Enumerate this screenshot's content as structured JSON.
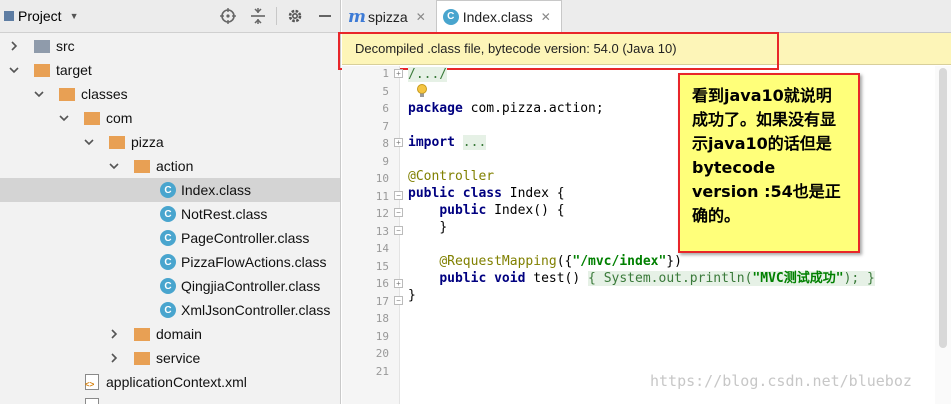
{
  "project": {
    "title": "Project",
    "tree": [
      {
        "label": "src",
        "icon": "folder-gray-icon",
        "expanded": false
      },
      {
        "label": "target",
        "icon": "folder-orange-icon",
        "expanded": true
      },
      {
        "label": "classes",
        "icon": "folder-orange-icon",
        "expanded": true
      },
      {
        "label": "com",
        "icon": "folder-orange-icon",
        "expanded": true
      },
      {
        "label": "pizza",
        "icon": "folder-orange-icon",
        "expanded": true
      },
      {
        "label": "action",
        "icon": "folder-orange-icon",
        "expanded": true
      },
      {
        "label": "Index.class",
        "icon": "class-icon",
        "selected": true
      },
      {
        "label": "NotRest.class",
        "icon": "class-icon"
      },
      {
        "label": "PageController.class",
        "icon": "class-icon"
      },
      {
        "label": "PizzaFlowActions.class",
        "icon": "class-icon"
      },
      {
        "label": "QingjiaController.class",
        "icon": "class-icon"
      },
      {
        "label": "XmlJsonController.class",
        "icon": "class-icon"
      },
      {
        "label": "domain",
        "icon": "folder-orange-icon",
        "expanded": false
      },
      {
        "label": "service",
        "icon": "folder-orange-icon",
        "expanded": false
      },
      {
        "label": "applicationContext.xml",
        "icon": "xml-file-icon"
      }
    ]
  },
  "tabs": [
    {
      "label": "spizza",
      "icon": "maven-m-icon",
      "active": false
    },
    {
      "label": "Index.class",
      "icon": "class-icon",
      "active": true
    }
  ],
  "banner": {
    "text": "Decompiled .class file, bytecode version: 54.0 (Java 10)"
  },
  "code": {
    "line_numbers": [
      "1",
      "5",
      "6",
      "7",
      "8",
      "9",
      "10",
      "11",
      "12",
      "13",
      "14",
      "15",
      "16",
      "17",
      "18",
      "19",
      "20",
      "21"
    ],
    "lines": {
      "l1": "/.../",
      "l6_kw": "package",
      "l6_rest": " com.pizza.action;",
      "l8_kw": "import",
      "l8_rest": "...",
      "l10": "@Controller",
      "l11_kw1": "public",
      "l11_kw2": "class",
      "l11_rest": " Index {",
      "l12_kw": "public",
      "l12_rest": " Index() {",
      "l13": "}",
      "l15_ann": "@RequestMapping",
      "l15_p1": "({",
      "l15_str": "\"/mvc/index\"",
      "l15_p2": "})",
      "l16_kw1": "public",
      "l16_kw2": "void",
      "l16_rest": " test() ",
      "l16_body1": "{",
      "l16_body2": " System.out.println(",
      "l16_str": "\"MVC测试成功\"",
      "l16_body3": "); ",
      "l16_body4": "}",
      "l17": "}"
    }
  },
  "annotation": {
    "text": "看到java10就说明成功了。如果没有显示java10的话但是bytecode version :54也是正确的。"
  },
  "watermark": "https://blog.csdn.net/blueboz",
  "colors": {
    "banner_bg": "#fdf5b8",
    "highlight_red": "#e8262a",
    "note_yellow": "#ffff7a",
    "folder_orange": "#e8a054",
    "class_blue": "#49a5ce"
  }
}
